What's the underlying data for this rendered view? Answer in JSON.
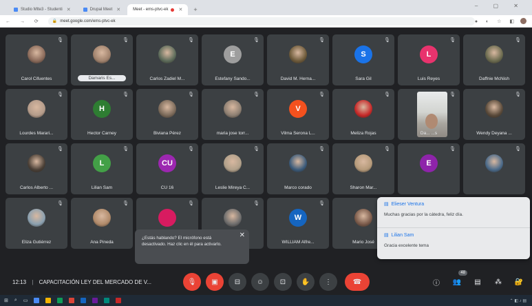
{
  "browser": {
    "tabs": [
      {
        "label": "Studio Mlte3 - Studenti",
        "active": false
      },
      {
        "label": "Drupal Meet",
        "active": false
      },
      {
        "label": "Meet - ems-ptvc-ek",
        "active": true
      }
    ],
    "url": "meet.google.com/ems-ptvc-ek"
  },
  "participants": [
    {
      "name": "Carol Cifuentes",
      "initial": "",
      "color": "#8a6a5a",
      "photo": true
    },
    {
      "name": "Damaris Es...",
      "initial": "",
      "color": "#a0826d",
      "photo": true,
      "pill": true
    },
    {
      "name": "Carlos Zadiel M...",
      "initial": "",
      "color": "#5c6b5a",
      "photo": true
    },
    {
      "name": "Estefany Sando...",
      "initial": "E",
      "color": "#9e9e9e"
    },
    {
      "name": "David M. Herna...",
      "initial": "",
      "color": "#6d5a3a",
      "photo": true
    },
    {
      "name": "Sara Gil",
      "initial": "S",
      "color": "#1a73e8"
    },
    {
      "name": "Luis Reyes",
      "initial": "L",
      "color": "#e8336d"
    },
    {
      "name": "Daffnie McNish",
      "initial": "",
      "color": "#6b6b4f",
      "photo": true
    },
    {
      "name": "Lourdes Marari...",
      "initial": "",
      "color": "#b39b8a",
      "photo": true
    },
    {
      "name": "Hector Carney",
      "initial": "H",
      "color": "#2e7d32"
    },
    {
      "name": "Biviana Pérez",
      "initial": "",
      "color": "#7b6a5a",
      "photo": true
    },
    {
      "name": "maria jose torr...",
      "initial": "",
      "color": "#8d7f72",
      "photo": true
    },
    {
      "name": "Vilma Serona L...",
      "initial": "V",
      "color": "#f4511e"
    },
    {
      "name": "Meliza Rojas",
      "initial": "",
      "color": "#c62828",
      "photo": true
    },
    {
      "name": "Da... ...s",
      "initial": "",
      "color": "#a9a69f",
      "video": true
    },
    {
      "name": "Wendy Deyana ...",
      "initial": "",
      "color": "#5a4a3a",
      "photo": true
    },
    {
      "name": "Carlos Alberto ...",
      "initial": "",
      "color": "#4a3f36",
      "photo": true
    },
    {
      "name": "Lilian Sam",
      "initial": "L",
      "color": "#43a047"
    },
    {
      "name": "CU 16",
      "initial": "CU",
      "color": "#9c27b0"
    },
    {
      "name": "Leslie Mireya C...",
      "initial": "",
      "color": "#b0a08a",
      "photo": true
    },
    {
      "name": "Marco corado",
      "initial": "",
      "color": "#3a5a7a",
      "photo": true
    },
    {
      "name": "Sharon Mar...",
      "initial": "",
      "color": "#b59a7a",
      "photo": true
    },
    {
      "name": "",
      "initial": "E",
      "color": "#8e24aa"
    },
    {
      "name": "",
      "initial": "",
      "color": "#4a6a8a",
      "photo": true
    },
    {
      "name": "Eliza Gutiérrez",
      "initial": "",
      "color": "#8aa0b0",
      "photo": true
    },
    {
      "name": "Ana Pineda",
      "initial": "",
      "color": "#b08a6a",
      "photo": true
    },
    {
      "name": "",
      "initial": "",
      "color": "#d81b60"
    },
    {
      "name": "",
      "initial": "",
      "color": "#6d6d6d",
      "photo": true
    },
    {
      "name": "WILLIAM Alfre...",
      "initial": "W",
      "color": "#1565c0"
    },
    {
      "name": "Mario José",
      "initial": "",
      "color": "#7a5a4a",
      "photo": true
    },
    {
      "name": "",
      "initial": "",
      "color": "#3c4043"
    },
    {
      "name": "",
      "initial": "",
      "color": "#3c4043"
    }
  ],
  "chat": {
    "messages": [
      {
        "sender": "Elieser Ventura",
        "text": "Muchas gracias por la cátedra, feliz día."
      },
      {
        "sender": "Lilian Sam",
        "text": "Gracia excelente tema"
      }
    ]
  },
  "toast": {
    "text": "¿Estás hablando? El micrófono está desactivado. Haz clic en él para activarlo."
  },
  "meeting": {
    "time": "12:13",
    "title": "CAPACITACIÓN LEY DEL MERCADO DE V..."
  },
  "people_count": "48",
  "colors": {
    "meet_bg": "#202124",
    "tile_bg": "#3c4043",
    "danger": "#ea4335"
  }
}
